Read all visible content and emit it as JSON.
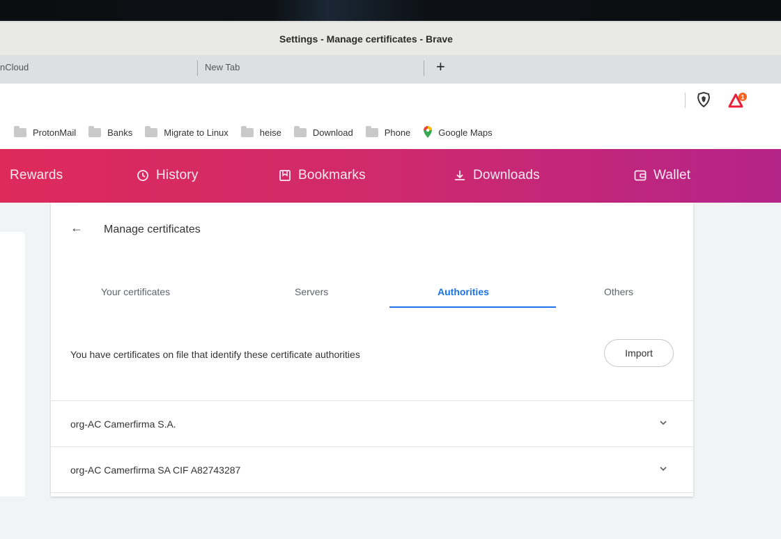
{
  "window": {
    "title": "Settings - Manage certificates - Brave"
  },
  "tabs": [
    {
      "label": "nCloud"
    },
    {
      "label": "New Tab"
    }
  ],
  "new_tab_glyph": "+",
  "toolbar": {
    "icons": [
      "brave-shield-icon",
      "brave-rewards-icon"
    ],
    "badge": "1"
  },
  "bookmarks": [
    {
      "label": "ProtonMail",
      "icon": "folder-icon"
    },
    {
      "label": "Banks",
      "icon": "folder-icon"
    },
    {
      "label": "Migrate to Linux",
      "icon": "folder-icon"
    },
    {
      "label": "heise",
      "icon": "folder-icon"
    },
    {
      "label": "Download",
      "icon": "folder-icon"
    },
    {
      "label": "Phone",
      "icon": "folder-icon"
    },
    {
      "label": "Google Maps",
      "icon": "maps-pin-icon"
    }
  ],
  "nav": {
    "items": [
      {
        "label": "Rewards"
      },
      {
        "label": "History",
        "icon": "history-icon"
      },
      {
        "label": "Bookmarks",
        "icon": "bookmarks-icon"
      },
      {
        "label": "Downloads",
        "icon": "download-icon"
      },
      {
        "label": "Wallet",
        "icon": "wallet-icon"
      }
    ],
    "gradient": [
      "#dd2a5b",
      "#b52489"
    ]
  },
  "page": {
    "title": "Manage certificates",
    "cert_tabs": [
      {
        "label": "Your certificates"
      },
      {
        "label": "Servers"
      },
      {
        "label": "Authorities",
        "active": true
      },
      {
        "label": "Others"
      }
    ],
    "description": "You have certificates on file that identify these certificate authorities",
    "import_label": "Import",
    "authorities": [
      {
        "label": "org-AC Camerfirma S.A."
      },
      {
        "label": "org-AC Camerfirma SA CIF A82743287"
      }
    ],
    "accent_color": "#1a73e8"
  }
}
